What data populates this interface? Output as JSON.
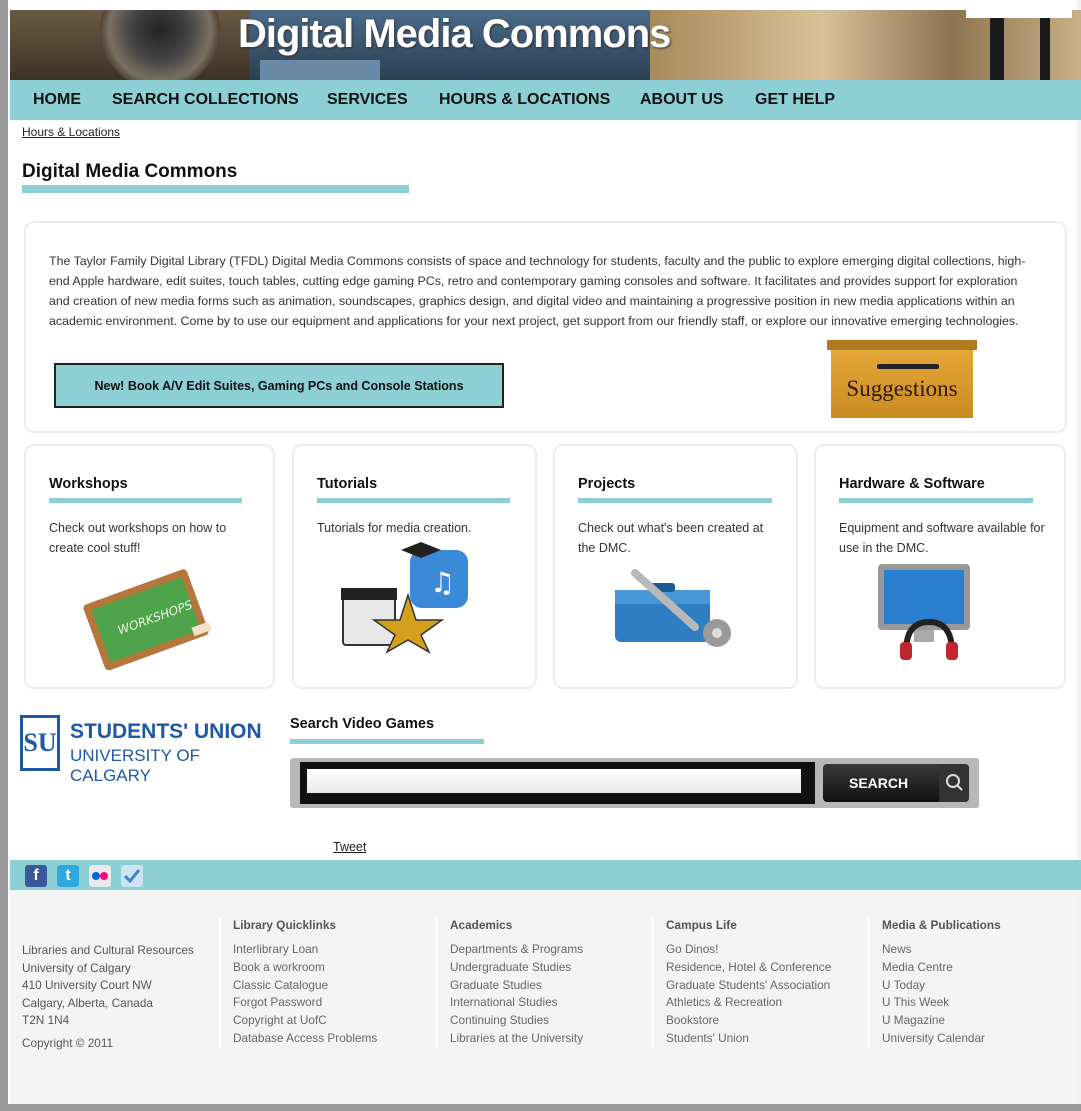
{
  "header": {
    "title": "Digital Media Commons"
  },
  "nav": {
    "items": [
      "HOME",
      "SEARCH COLLECTIONS",
      "SERVICES",
      "HOURS & LOCATIONS",
      "ABOUT US",
      "GET HELP"
    ]
  },
  "breadcrumb": "Hours & Locations",
  "page_title": "Digital Media Commons",
  "intro": {
    "text": "The Taylor Family Digital Library (TFDL) Digital Media Commons consists of space and technology for students, faculty and the public to explore emerging digital collections, high-end Apple hardware, edit suites, touch tables, cutting edge gaming PCs, retro and contemporary gaming consoles and software. It facilitates and provides support for exploration and creation of new media forms such as animation, soundscapes, graphics design, and digital video and maintaining a progressive position in new media applications within an academic environment. Come by to use our equipment and applications for your next project, get support from our friendly staff, or explore our innovative emerging technologies.",
    "button": "New! Book A/V Edit Suites, Gaming PCs and Console Stations",
    "suggestions": "Suggestions"
  },
  "cards": [
    {
      "title": "Workshops",
      "desc": "Check out workshops on how to create cool stuff!",
      "image_text": "WORKSHOPS"
    },
    {
      "title": "Tutorials",
      "desc": "Tutorials for media creation."
    },
    {
      "title": "Projects",
      "desc": "Check out what's been created at the DMC."
    },
    {
      "title": "Hardware & Software",
      "desc": "Equipment and software available for use in the DMC."
    }
  ],
  "su_logo": {
    "line1": "STUDENTS' UNION",
    "line2": "UNIVERSITY OF CALGARY",
    "mark": "SU"
  },
  "search": {
    "heading": "Search Video Games",
    "button": "SEARCH",
    "value": ""
  },
  "tweet": "Tweet",
  "social": [
    "facebook-icon",
    "twitter-icon",
    "flickr-icon",
    "foursquare-icon"
  ],
  "footer": {
    "address": [
      "Libraries and Cultural Resources",
      "University of Calgary",
      "410 University Court NW",
      "Calgary, Alberta, Canada",
      "T2N 1N4"
    ],
    "copyright": "Copyright © 2011",
    "columns": [
      {
        "title": "Library Quicklinks",
        "links": [
          "Interlibrary Loan",
          "Book a workroom",
          "Classic Catalogue",
          "Forgot Password",
          "Copyright at UofC",
          "Database Access Problems"
        ]
      },
      {
        "title": "Academics",
        "links": [
          "Departments & Programs",
          "Undergraduate Studies",
          "Graduate Studies",
          "International Studies",
          "Continuing Studies",
          "Libraries at the University"
        ]
      },
      {
        "title": "Campus Life",
        "links": [
          "Go Dinos!",
          "Residence, Hotel & Conference",
          "Graduate Students' Association",
          "Athletics & Recreation",
          "Bookstore",
          "Students' Union"
        ]
      },
      {
        "title": "Media & Publications",
        "links": [
          "News",
          "Media Centre",
          "U Today",
          "U This Week",
          "U Magazine",
          "University Calendar"
        ]
      }
    ]
  },
  "colors": {
    "accent": "#8ccfd5",
    "frame": "#9a9a9a"
  }
}
